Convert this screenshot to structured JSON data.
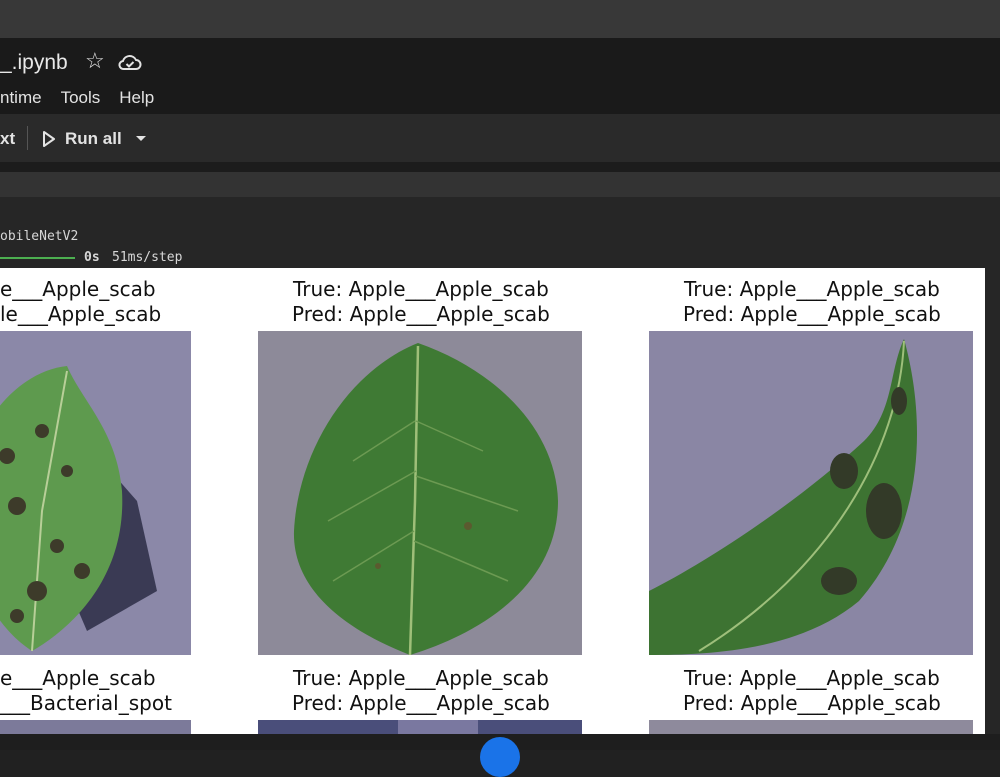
{
  "notebook": {
    "title": "_.ipynb",
    "menu": [
      "ntime",
      "Tools",
      "Help"
    ]
  },
  "toolbar": {
    "text_label": "xt",
    "run_all_label": "Run all"
  },
  "output": {
    "line1": "obileNetV2",
    "time": "0s",
    "step": "51ms/step"
  },
  "figure": {
    "row1": [
      {
        "true": "e___Apple_scab",
        "pred": "le___Apple_scab"
      },
      {
        "true": "True: Apple___Apple_scab",
        "pred": "Pred: Apple___Apple_scab"
      },
      {
        "true": "True: Apple___Apple_scab",
        "pred": "Pred: Apple___Apple_scab"
      }
    ],
    "row2": [
      {
        "true": "e___Apple_scab",
        "pred": "___Bacterial_spot"
      },
      {
        "true": "True: Apple___Apple_scab",
        "pred": "Pred: Apple___Apple_scab"
      },
      {
        "true": "True: Apple___Apple_scab",
        "pred": "Pred: Apple___Apple_scab"
      }
    ]
  },
  "colors": {
    "accent": "#1a73e8",
    "progress": "#4caf50",
    "leaf_bg": "#8b88a8"
  }
}
